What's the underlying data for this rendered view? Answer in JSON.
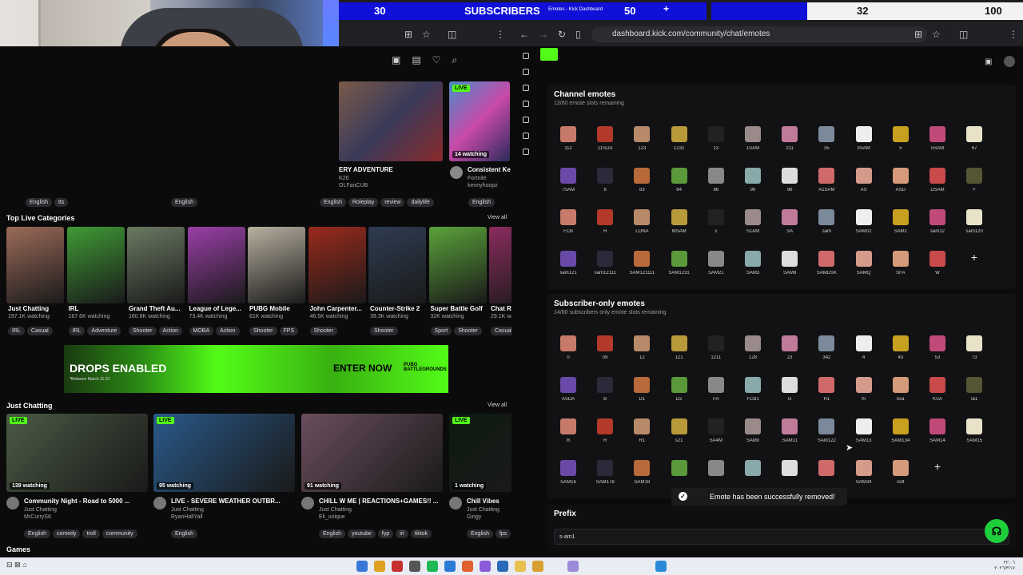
{
  "scoreboard": {
    "left_value": "30",
    "title": "SUBSCRIBERS",
    "mid_value": "50",
    "right_value": "32",
    "max_value": "100"
  },
  "browser_right": {
    "tab_title": "Emotes - Kick Dashboard",
    "url": "dashboard.kick.com/community/chat/emotes"
  },
  "left_page": {
    "top_tags": [
      "English",
      "tts",
      "English"
    ],
    "featured": [
      {
        "title": "ERY ADVENTURE",
        "sub1": "K26",
        "sub2": "OLFanCUB",
        "tags": [
          "English",
          "irl",
          "Roleplay",
          "review",
          "dailylife"
        ]
      },
      {
        "title": "Consistent Ke",
        "sub1": "Fortnite",
        "sub2": "kennyhoopz",
        "watching": "14 watching",
        "tags": [
          "English"
        ]
      }
    ],
    "top_categories_title": "Top Live Categories",
    "view_all": "View all",
    "categories": [
      {
        "name": "Just Chatting",
        "watching": "197.1K watching",
        "tags": [
          "IRL",
          "Casual"
        ],
        "color": "#9c6b5a"
      },
      {
        "name": "IRL",
        "watching": "167.6K watching",
        "tags": [
          "IRL",
          "Adventure"
        ],
        "color": "#3f9a35"
      },
      {
        "name": "Grand Theft Au...",
        "watching": "160.8K watching",
        "tags": [
          "Shooter",
          "Action"
        ],
        "color": "#6b7a62"
      },
      {
        "name": "League of Lege...",
        "watching": "73.4K watching",
        "tags": [
          "MOBA",
          "Action"
        ],
        "color": "#9a3fa7"
      },
      {
        "name": "PUBG Mobile",
        "watching": "61K watching",
        "tags": [
          "Shooter",
          "FPS"
        ],
        "color": "#b8b0a0"
      },
      {
        "name": "John Carpenter...",
        "watching": "46.5K watching",
        "tags": [
          "Shooter"
        ],
        "color": "#9a2a1c"
      },
      {
        "name": "Counter-Strike 2",
        "watching": "39.3K watching",
        "tags": [
          "Shooter"
        ],
        "color": "#2e3c52"
      },
      {
        "name": "Super Battle Golf",
        "watching": "32K watching",
        "tags": [
          "Sport",
          "Shooter"
        ],
        "color": "#5aa23a"
      },
      {
        "name": "Chat Ro",
        "watching": "29.1K watching",
        "tags": [
          "Casual"
        ],
        "color": "#8a2b5e"
      }
    ],
    "banner": {
      "left": "DROPS ENABLED",
      "sub": "*Between March 11-31",
      "cta": "ENTER NOW",
      "brand": "PUBG BATTLEGROUNDS"
    },
    "just_chatting_title": "Just Chatting",
    "streams": [
      {
        "live": "LIVE",
        "watching": "139 watching",
        "title": "Community Night - Road to 5000 ...",
        "cat": "Just Chatting",
        "user": "MrCurryS6",
        "tags": [
          "English",
          "comedy",
          "troll",
          "community"
        ],
        "color": "#4a5a44"
      },
      {
        "live": "LIVE",
        "watching": "95 watching",
        "title": "LIVE - SEVERE WEATHER OUTBR...",
        "cat": "Just Chatting",
        "user": "RyanHallYall",
        "tags": [
          "English"
        ],
        "color": "#2a5a8a"
      },
      {
        "live": "",
        "watching": "91 watching",
        "title": "CHILL W ME | REACTIONS+GAMES!! ...",
        "cat": "Just Chatting",
        "user": "Eli_unique",
        "tags": [
          "English",
          "youtube",
          "fyp",
          "irl",
          "tiktok"
        ],
        "color": "#6a4e5e"
      },
      {
        "live": "LIVE",
        "watching": "1 watching",
        "title": "Chill Vibes",
        "cat": "Just Chatting",
        "user": "Gingy",
        "tags": [
          "English",
          "fps"
        ],
        "color": "#0d1a0f"
      }
    ],
    "games_title": "Games"
  },
  "dashboard": {
    "channel_title": "Channel emotes",
    "channel_sub": "13/60 emote slots remaining",
    "channel_emotes": [
      [
        "112",
        "11SDA",
        "123",
        "1232",
        "13",
        "1SAM",
        "211",
        "35",
        "3SAM",
        "5",
        "5SAM",
        "67"
      ],
      [
        "7SAM",
        "8",
        "83",
        "84",
        "86",
        "96",
        "98",
        "A1SAM",
        "AS",
        "ASD",
        "DSAM",
        "F"
      ],
      [
        "FCB",
        "H",
        "LONA",
        "MSAM",
        "s",
        "S1AM",
        "SA",
        "sam",
        "SAM02",
        "SAM1",
        "sam12",
        "sam120"
      ],
      [
        "sam121",
        "sam12111",
        "SAM121111",
        "SAM1231",
        "SAM21",
        "SAM3",
        "SAM8",
        "SAMDSK",
        "SAMQ",
        "SFA",
        "W"
      ]
    ],
    "sub_title": "Subscriber-only emotes",
    "sub_sub": "14/60 subscribers only emote slots remaining",
    "sub_emotes": [
      [
        "0",
        "09",
        "12",
        "121",
        "1211",
        "128",
        "23",
        "342",
        "4",
        "43",
        "53",
        "73"
      ],
      [
        "ASDA",
        "B",
        "D1",
        "D2",
        "FA",
        "FCB1",
        "G",
        "H1",
        "hi",
        "ksa",
        "KSA",
        "la1"
      ],
      [
        "m",
        "R",
        "R1",
        "s21",
        "SA4M",
        "SAM0",
        "SAM11",
        "SAM122",
        "SAM13",
        "SAM134",
        "SAM14",
        "SAM15"
      ],
      [
        "SAM16",
        "SAM178",
        "SAM18",
        "",
        "",
        "",
        "",
        "",
        "SAM34",
        "volt"
      ]
    ],
    "emote_colors": [
      "#c77a6a",
      "#7a8a9a",
      "#b86a3a",
      "#d49a7a",
      "#222",
      "#e8e3c8",
      "#ddd",
      "#b33a2a",
      "#eee",
      "#5a9a3a",
      "#c84a4a",
      "#9a8a8a",
      "#6a4aa8",
      "#d06a6a",
      "#b88a6a",
      "#c8a020",
      "#888",
      "#553",
      "#c07a9a",
      "#2a2a3a",
      "#d49a8a",
      "#b89a3a",
      "#c04a7a",
      "#8aa"
    ],
    "toast": "Emote has been successfully removed!",
    "prefix_title": "Prefix",
    "prefix_value": "s-am1"
  },
  "taskbar": {
    "time": "٢٢:٠٦",
    "date": "٢٠٢٦/٣/١٧"
  }
}
